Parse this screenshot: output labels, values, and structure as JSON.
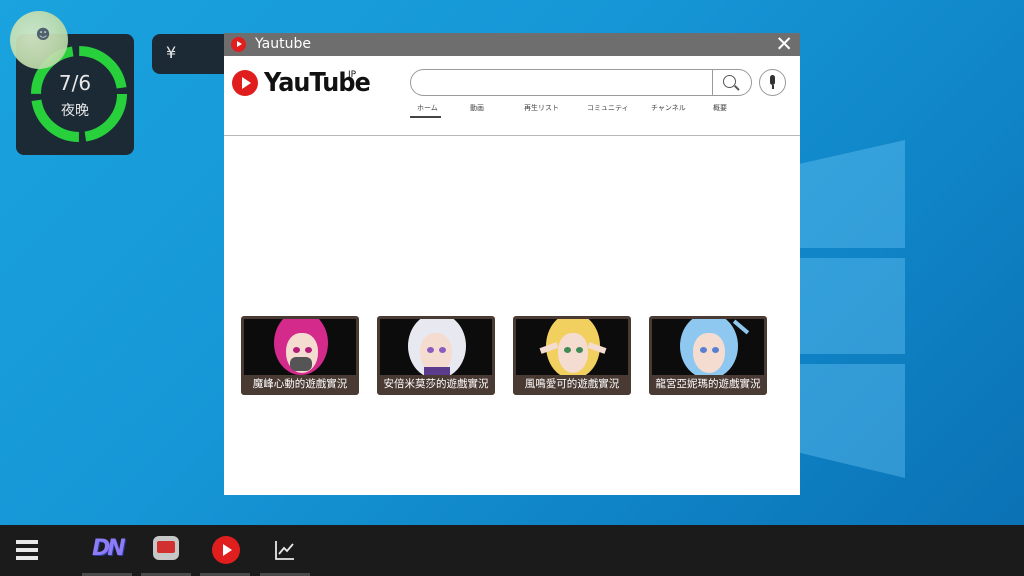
{
  "desktop": {
    "day_widget": {
      "date": "7/6",
      "period": "夜晚",
      "ring_color": "#28d13c",
      "avatar_icon": "character-avatar-icon"
    },
    "money_widget": {
      "symbol": "¥",
      "value": ""
    }
  },
  "window": {
    "title": "Yautube",
    "close_label": "✕",
    "logo_text": "YauTube",
    "logo_region": "JP",
    "search": {
      "placeholder": "",
      "value": ""
    },
    "nav_tabs": [
      {
        "label": "ホーム",
        "active": true
      },
      {
        "label": "動画"
      },
      {
        "label": "再生リスト"
      },
      {
        "label": "コミュニティ"
      },
      {
        "label": "チャンネル"
      },
      {
        "label": "概要"
      }
    ],
    "videos": [
      {
        "title": "魔峰心動的遊戲實況",
        "hair_color": "#d42a8c"
      },
      {
        "title": "安倍米莫莎的遊戲實況",
        "hair_color": "#e8e8f0"
      },
      {
        "title": "風鳴愛可的遊戲實況",
        "hair_color": "#f2d060"
      },
      {
        "title": "龍宮亞妮瑪的遊戲實況",
        "hair_color": "#8ec8f0"
      }
    ]
  },
  "taskbar": {
    "apps": [
      {
        "name": "dn-app",
        "label": "DN"
      },
      {
        "name": "stream-app"
      },
      {
        "name": "yautube-app"
      },
      {
        "name": "stats-app"
      }
    ]
  },
  "colors": {
    "accent_red": "#e01e1e",
    "taskbar_bg": "#1b1b1b",
    "desktop_blue": "#1696d6"
  }
}
